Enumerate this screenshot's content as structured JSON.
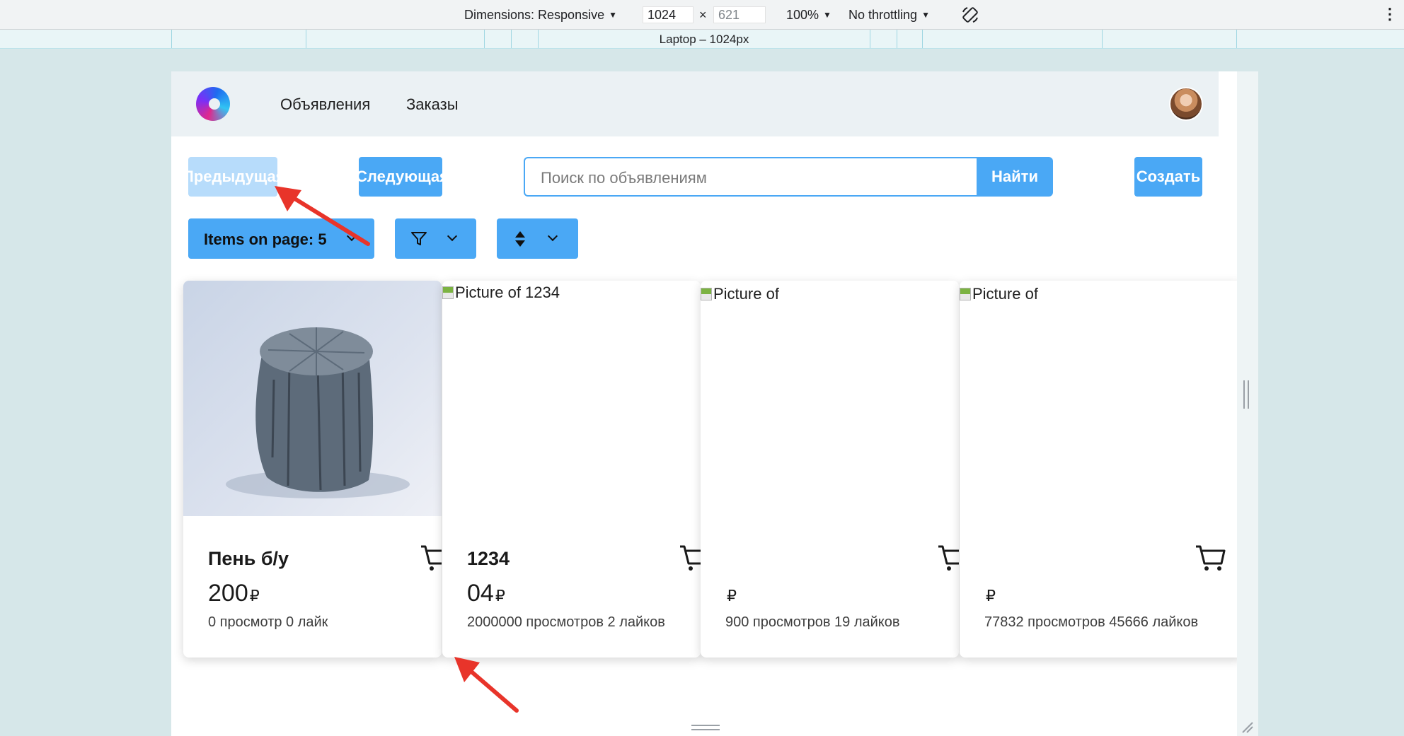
{
  "devtools": {
    "dimensions_label": "Dimensions: Responsive",
    "width": "1024",
    "height_placeholder": "621",
    "times": "×",
    "zoom": "100%",
    "throttling": "No throttling",
    "more": "⋮",
    "ruler_label": "Laptop – 1024px"
  },
  "header": {
    "nav": [
      "Объявления",
      "Заказы"
    ]
  },
  "toolbar": {
    "prev_label": "Предыдущая",
    "next_label": "Следующая",
    "search_placeholder": "Поиск по объявлениям",
    "search_button": "Найти",
    "create_button": "Создать"
  },
  "filters": {
    "items_on_page": "Items on page: 5",
    "filter_icon": "filter-icon",
    "sort_icon": "sort-icon"
  },
  "cards": [
    {
      "image_alt": "",
      "title": "Пень б/у",
      "price": "200",
      "currency": "₽",
      "stats": "0 просмотр  0 лайк"
    },
    {
      "image_alt": "Picture of 1234",
      "title": "1234",
      "price": "04",
      "currency": "₽",
      "stats": "2000000 просмотров  2 лайков"
    },
    {
      "image_alt": "Picture of",
      "title": "",
      "price": "",
      "currency": "₽",
      "stats": "900 просмотров  19 лайков"
    },
    {
      "image_alt": "Picture of",
      "title": "",
      "price": "",
      "currency": "₽",
      "stats": "77832 просмотров  45666 лайков"
    }
  ],
  "colors": {
    "primary": "#4aa8f5",
    "primary_disabled": "#b7dcfb",
    "header_bg": "#ebf1f4",
    "annotation_arrow": "#e8342a"
  }
}
